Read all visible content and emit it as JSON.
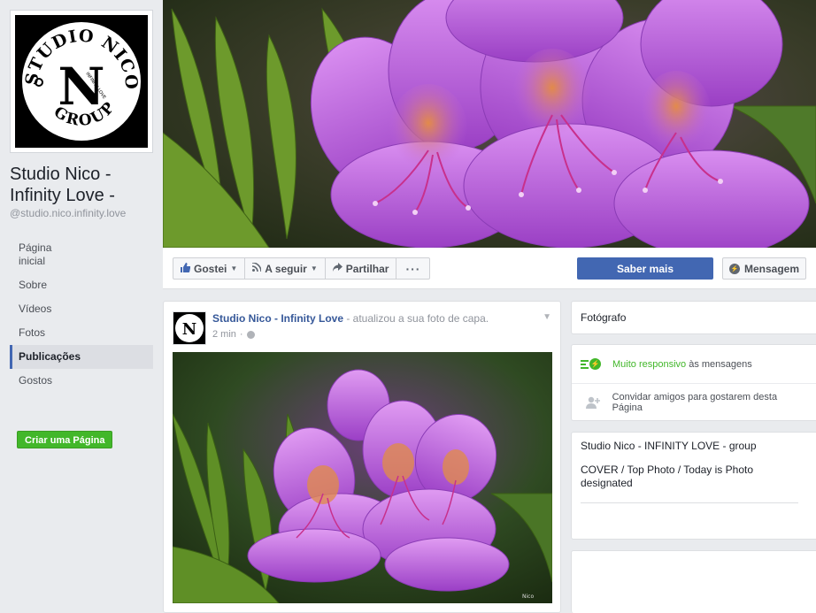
{
  "page": {
    "name": "Studio Nico - Infinity Love -",
    "handle": "@studio.nico.infinity.love",
    "logo_text_top": "STUDIO NICO",
    "logo_text_bottom": "GROUP",
    "logo_letter": "N",
    "logo_caption": "INFINITY LOVE"
  },
  "left_nav": {
    "items": [
      {
        "label": "Página inicial"
      },
      {
        "label": "Sobre"
      },
      {
        "label": "Vídeos"
      },
      {
        "label": "Fotos"
      },
      {
        "label": "Publicações"
      },
      {
        "label": "Gostos"
      }
    ],
    "active_index": 4,
    "create_page_label": "Criar uma Página"
  },
  "action_bar": {
    "like_label": "Gostei",
    "follow_label": "A seguir",
    "share_label": "Partilhar",
    "more_label": "···",
    "cta_label": "Saber mais",
    "message_label": "Mensagem"
  },
  "post": {
    "author": "Studio Nico - Infinity Love",
    "action_text": " - atualizou a sua foto de capa.",
    "time": "2 min",
    "photo_watermark": "Nico"
  },
  "right_column": {
    "category": "Fotógrafo",
    "responsive_highlight": "Muito responsivo",
    "responsive_rest": " às mensagens",
    "invite_text": "Convidar amigos para gostarem desta Página",
    "about_line1": "Studio Nico - INFINITY LOVE - group",
    "about_line2": "COVER / Top Photo / Today is Photo designated"
  },
  "colors": {
    "brand_blue": "#4267b2",
    "link_blue": "#365899",
    "green": "#42b72a",
    "flower_purple": "#b455d6"
  },
  "icons": [
    "like-icon",
    "rss-icon",
    "share-icon",
    "messenger-icon",
    "add-friend-icon",
    "globe-icon",
    "chevron-down-icon"
  ]
}
